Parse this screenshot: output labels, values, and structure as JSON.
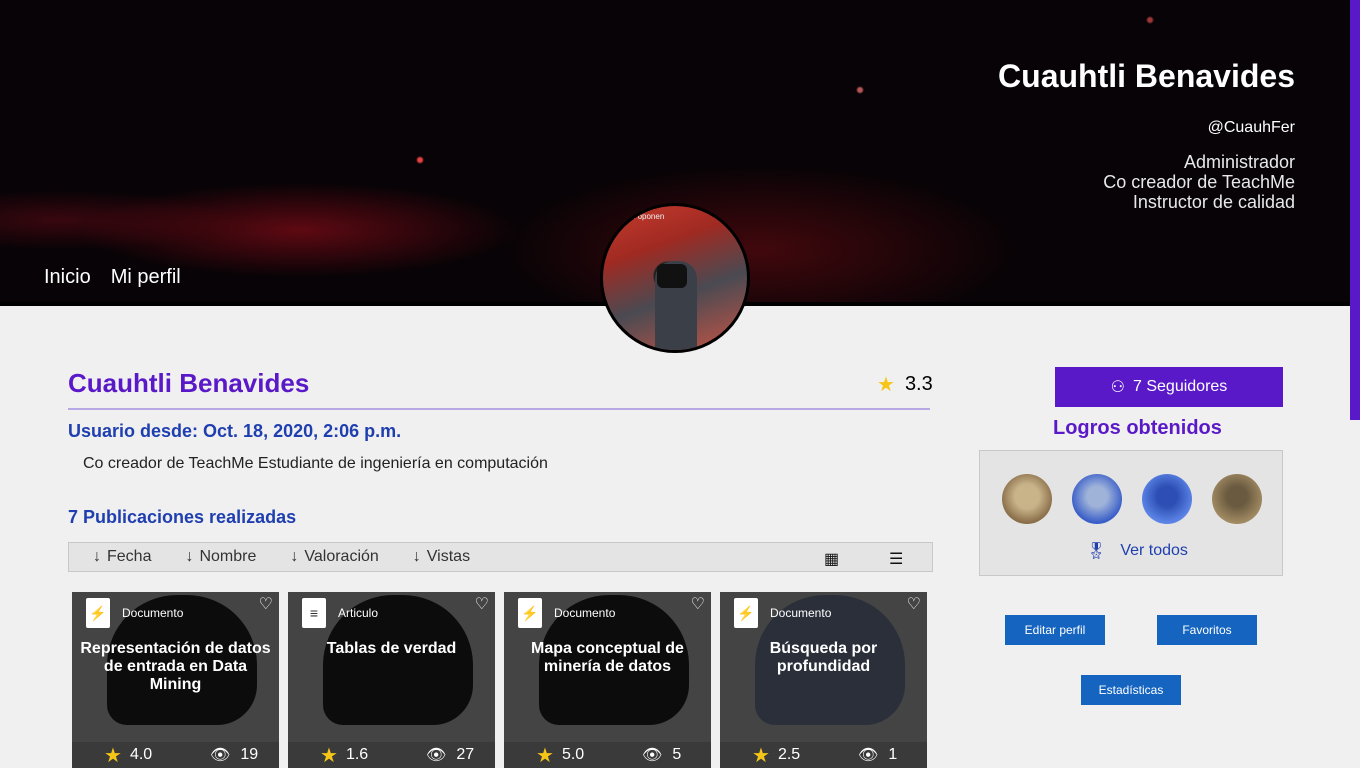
{
  "header": {
    "name": "Cuauhtli Benavides",
    "handle": "@CuauhFer",
    "roles": [
      "Administrador",
      "Co creador de TeachMe",
      "Instructor de calidad"
    ],
    "nav": [
      "Inicio",
      "Mi perfil"
    ],
    "avatar_caption": "a tus oponen"
  },
  "profile": {
    "name": "Cuauhtli Benavides",
    "rating": "3.3",
    "since": "Usuario desde: Oct. 18, 2020, 2:06 p.m.",
    "bio": "Co creador de TeachMe Estudiante de ingeniería en computación",
    "publications": "7 Publicaciones realizadas"
  },
  "sort": [
    "Fecha",
    "Nombre",
    "Valoración",
    "Vistas"
  ],
  "cards": [
    {
      "type": "Documento",
      "title": "Representación de datos de entrada en Data Mining",
      "rating": "4.0",
      "views": "19",
      "icon": "pdf-icon"
    },
    {
      "type": "Articulo",
      "title": "Tablas de verdad",
      "rating": "1.6",
      "views": "27",
      "icon": "article-icon"
    },
    {
      "type": "Documento",
      "title": "Mapa conceptual de minería de datos",
      "rating": "5.0",
      "views": "5",
      "icon": "pdf-icon"
    },
    {
      "type": "Documento",
      "title": "Búsqueda por profundidad",
      "rating": "2.5",
      "views": "1",
      "icon": "pdf-icon"
    }
  ],
  "sidebar": {
    "followers": "7 Seguidores",
    "logros_title": "Logros obtenidos",
    "ver_todos": "Ver todos",
    "buttons": [
      "Editar perfil",
      "Favoritos",
      "Estadísticas"
    ]
  },
  "colors": {
    "accent": "#5a19c8",
    "link": "#1f3fb0",
    "button": "#1565c0",
    "star": "#f5c518"
  }
}
